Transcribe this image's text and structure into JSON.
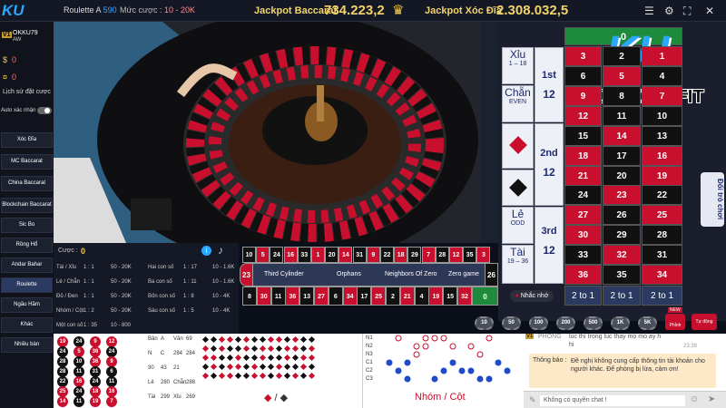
{
  "header": {
    "logo": "KU",
    "table_name": "Roulette A",
    "table_number": "590",
    "bet_limit_label": "Mức cược :",
    "bet_limit_value": "10 - 20K",
    "jackpot_1_label": "Jackpot Baccarat",
    "jackpot_1_value": "734.223,2",
    "jackpot_2_label": "Jackpot Xóc Đĩa",
    "jackpot_2_value": "2.308.032,5"
  },
  "sidebar": {
    "badge": "V1",
    "user_name": "OKKU79",
    "user_sub": "AW",
    "balance_1": "0",
    "balance_2": "0",
    "history_label": "Lịch sử đặt cược",
    "auto_confirm_label": "Auto xác nhận",
    "items": [
      {
        "label": "Xóc Đĩa"
      },
      {
        "label": "MC Baccarat"
      },
      {
        "label": "China Baccarat"
      },
      {
        "label": "Blockchain Baccarat"
      },
      {
        "label": "Sic Bo"
      },
      {
        "label": "Rồng Hổ"
      },
      {
        "label": "Andar Bahar"
      },
      {
        "label": "Roulette"
      },
      {
        "label": "Ngầu Hầm"
      },
      {
        "label": "Khác"
      },
      {
        "label": "Nhiều bàn"
      }
    ]
  },
  "watermark": {
    "logo": "KU",
    "site": "KUBET11.FIT"
  },
  "board": {
    "xiu": "Xỉu",
    "xiu_range": "1 – 18",
    "chan": "Chẵn",
    "chan_sub": "EVEN",
    "le": "Lẻ",
    "le_sub": "ODD",
    "tai": "Tài",
    "tai_range": "19 – 36",
    "dozen_1": "1st",
    "dozen_2": "2nd",
    "dozen_3": "3rd",
    "dozen_val": "12",
    "two_to_one": "2 to 1",
    "zero": "0",
    "side_tab": "Đổi trò chơi",
    "grid_rows": [
      [
        3,
        2,
        1
      ],
      [
        6,
        5,
        4
      ],
      [
        9,
        8,
        7
      ],
      [
        12,
        11,
        10
      ],
      [
        15,
        14,
        13
      ],
      [
        18,
        17,
        16
      ],
      [
        21,
        20,
        19
      ],
      [
        24,
        23,
        22
      ],
      [
        27,
        26,
        25
      ],
      [
        30,
        29,
        28
      ],
      [
        33,
        32,
        31
      ],
      [
        36,
        35,
        34
      ]
    ],
    "red_numbers": [
      1,
      3,
      5,
      7,
      9,
      12,
      14,
      16,
      18,
      19,
      21,
      23,
      25,
      27,
      30,
      32,
      34,
      36
    ]
  },
  "stats": {
    "bet_label": "Cược :",
    "bet_value": "0",
    "rows": [
      [
        "Tài / Xỉu",
        "1 : 1",
        "50 - 20K",
        "Hai con số",
        "1 : 17",
        "10 - 1.6K"
      ],
      [
        "Lẻ / Chẵn",
        "1 : 1",
        "50 - 20K",
        "Ba con số",
        "1 : 11",
        "10 - 1.6K"
      ],
      [
        "Đỏ / Đen",
        "1 : 1",
        "50 - 20K",
        "Bốn con số",
        "1 : 8",
        "10 - 4K"
      ],
      [
        "Nhóm / Cột",
        "1 : 2",
        "50 - 20K",
        "Sáu con số",
        "1 : 5",
        "10 - 4K"
      ],
      [
        "Một con số",
        "1 : 35",
        "10 - 800",
        "",
        "",
        ""
      ]
    ]
  },
  "racetrack": {
    "top": [
      "10",
      "5",
      "24",
      "16",
      "33",
      "1",
      "20",
      "14",
      "31",
      "9",
      "22",
      "18",
      "29",
      "7",
      "28",
      "12",
      "35",
      "3"
    ],
    "bottom": [
      "8",
      "30",
      "11",
      "36",
      "13",
      "27",
      "6",
      "34",
      "17",
      "25",
      "2",
      "21",
      "4",
      "19",
      "15",
      "32"
    ],
    "left": "23",
    "right_top": "26",
    "right_bottom": "0",
    "zones": [
      "Third Cylinder",
      "Orphans",
      "Neighbors Of Zero",
      "Zero game"
    ],
    "reminder_label": "Nhắc nhớ"
  },
  "chips": [
    "10",
    "50",
    "100",
    "200",
    "500",
    "1K",
    "5K"
  ],
  "chips_extra": {
    "new_badge": "NEW",
    "rebet_label": "Phỉnh",
    "stat_label": "Tự động"
  },
  "roadmap": {
    "balls": [
      [
        19,
        24,
        9,
        12
      ],
      [
        24,
        5,
        36,
        24
      ],
      [
        28,
        10,
        36,
        9
      ],
      [
        28,
        11,
        31,
        6
      ],
      [
        22,
        16,
        24,
        11
      ],
      [
        25,
        24,
        18,
        16
      ],
      [
        14,
        11,
        19,
        7
      ]
    ],
    "summary": [
      [
        "Bản",
        "A",
        "Văn",
        "69"
      ],
      [
        "N",
        "C",
        "284",
        "284"
      ],
      [
        "30",
        "43",
        "21"
      ],
      [
        "Lẻ",
        "280",
        "Chẵn",
        "288"
      ],
      [
        "Tài",
        "299",
        "Xỉu",
        "269"
      ]
    ],
    "bottom_mid": "/",
    "group_col_label": "Nhóm / Cột",
    "row_labels": [
      "N1",
      "N2",
      "N3",
      "C1",
      "C2",
      "C3"
    ]
  },
  "chat": {
    "header_badge": "V1",
    "header_name": "PHONG",
    "first_msg": "lúc thì trong lúc thay mo mo ay h",
    "first_msg_2": "hi",
    "time": "23:39",
    "notice_title": "Thông báo :",
    "notice_text": "Đề nghị không cung cấp thông tin tài khoản cho người khác. Để phòng bị lừa, cảm ơn!",
    "input_placeholder": "Không có quyền chat !"
  },
  "colors": {
    "red": "#c8102e",
    "black": "#111111",
    "green": "#1d8a3c",
    "gold": "#f2d36b",
    "accent": "#2aa7ff"
  }
}
